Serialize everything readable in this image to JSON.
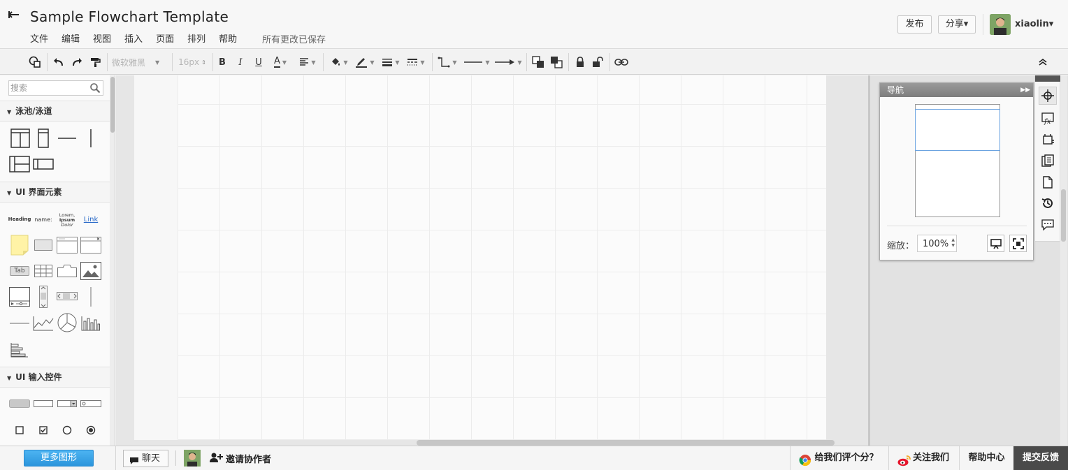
{
  "header": {
    "title": "Sample Flowchart Template",
    "menus": [
      "文件",
      "编辑",
      "视图",
      "插入",
      "页面",
      "排列",
      "帮助"
    ],
    "save_status": "所有更改已保存",
    "publish_label": "发布",
    "share_label": "分享▾",
    "username": "xiaolin▾"
  },
  "toolbar": {
    "font_family": "微软雅黑",
    "font_size": "16px",
    "bold": "B",
    "italic": "I",
    "underline": "U",
    "font_color": "A"
  },
  "left_panel": {
    "search_placeholder": "搜索",
    "categories": {
      "swimlane": "泳池/泳道",
      "ui_elements": "UI 界面元素",
      "ui_inputs": "UI 输入控件"
    },
    "ui_text_shapes": {
      "heading": "Heading",
      "name": "name:",
      "lorem": [
        "Lorem,",
        "Ipsum",
        "Dolor"
      ],
      "link": "Link",
      "tab": "Tab"
    }
  },
  "navigator": {
    "title": "导航",
    "zoom_label": "缩放：",
    "zoom_value": "100%"
  },
  "footer": {
    "more_shapes": "更多图形",
    "chat": "聊天",
    "invite": "邀请协作者",
    "rate": "给我们评个分？",
    "follow": "关注我们",
    "help": "帮助中心",
    "feedback": "提交反馈"
  },
  "colors": {
    "accent_blue": "#2b95dc",
    "nav_viewport": "#6ba3e0",
    "feedback_bg": "#4a4a4a",
    "sticky_note": "#fff3a6"
  },
  "icons": {
    "back": "back-arrow-icon",
    "undo": "undo-icon",
    "redo": "redo-icon",
    "format_painter": "format-painter-icon",
    "fill": "fill-bucket-icon",
    "line_color": "pen-icon",
    "lock": "lock-icon",
    "unlock": "unlock-icon",
    "link": "link-icon"
  }
}
